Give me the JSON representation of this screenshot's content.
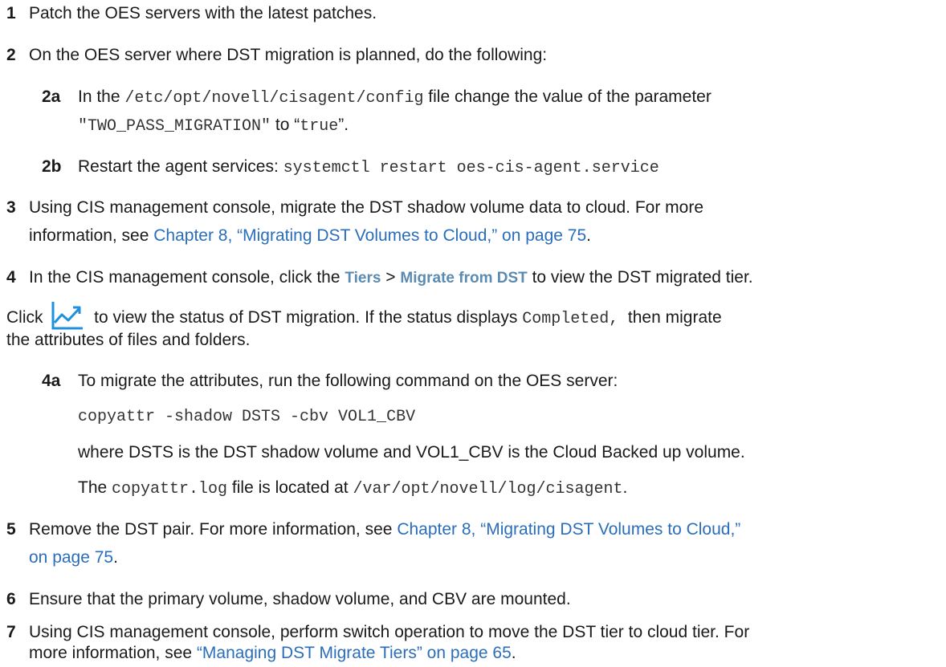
{
  "steps": {
    "s1": {
      "num": "1",
      "text": "Patch the OES servers with the latest patches."
    },
    "s2": {
      "num": "2",
      "text": "On the OES server where DST migration is planned, do the following:"
    },
    "s2a": {
      "num": "2a",
      "t1": "In the ",
      "path": "/etc/opt/novell/cisagent/config",
      "t2": " file change the value of the parameter",
      "param": "\"TWO_PASS_MIGRATION\"",
      "t3": " to “",
      "val": "true",
      "t4": "”."
    },
    "s2b": {
      "num": "2b",
      "t1": "Restart the agent services: ",
      "cmd": "systemctl restart oes-cis-agent.service"
    },
    "s3": {
      "num": "3",
      "t1": "Using CIS management console, migrate the DST shadow volume data to cloud. For more",
      "t2": "information, see ",
      "link": "Chapter 8, “Migrating DST Volumes to Cloud,” on page 75",
      "t3": "."
    },
    "s4": {
      "num": "4",
      "t1": "In the CIS management console, click the ",
      "ui1": "Tiers",
      "sep": " > ",
      "ui2": "Migrate from DST",
      "t2": " to view the DST migrated tier."
    },
    "s4p": {
      "t1": "Click ",
      "t2": " to view the status of DST migration. If the status displays ",
      "status": "Completed,",
      "t3": "  then migrate",
      "t4": "the attributes of files and folders."
    },
    "s4a": {
      "num": "4a",
      "t1": "To migrate the attributes, run the following command on the OES server:",
      "cmd": "copyattr -shadow DSTS -cbv VOL1_CBV",
      "t2": "where DSTS is the DST shadow volume and VOL1_CBV is the Cloud Backed up volume.",
      "t3": "The ",
      "file": "copyattr.log",
      "t4": " file is located at ",
      "path": "/var/opt/novell/log/cisagent",
      "t5": "."
    },
    "s5": {
      "num": "5",
      "t1": "Remove the DST pair. For more information, see ",
      "link1": "Chapter 8, “Migrating DST Volumes to Cloud,”",
      "link2": "on page 75",
      "t2": "."
    },
    "s6": {
      "num": "6",
      "text": "Ensure that the primary volume, shadow volume, and CBV are mounted."
    },
    "s7": {
      "num": "7",
      "t1": "Using CIS management console, perform switch operation to move the DST tier to cloud tier. For",
      "t2": "more information, see ",
      "link": "“Managing DST Migrate Tiers” on page 65",
      "t3": "."
    }
  },
  "icon": {
    "name": "trend-chart-icon",
    "color": "#1f8fe0"
  }
}
